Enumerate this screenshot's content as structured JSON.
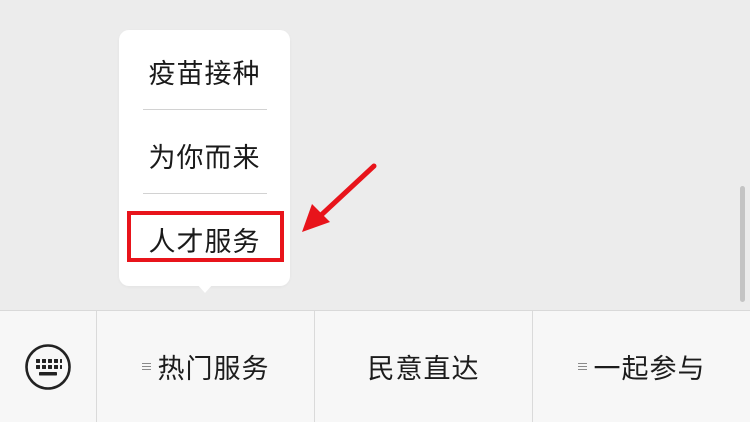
{
  "submenu": {
    "items": [
      {
        "label": "疫苗接种"
      },
      {
        "label": "为你而来"
      },
      {
        "label": "人才服务"
      }
    ],
    "highlighted_index": 2
  },
  "menu_bar": {
    "keyboard_icon": "keyboard-icon",
    "items": [
      {
        "label": "热门服务",
        "has_submenu": true
      },
      {
        "label": "民意直达",
        "has_submenu": false
      },
      {
        "label": "一起参与",
        "has_submenu": true
      }
    ]
  },
  "colors": {
    "highlight": "#e8141b",
    "background": "#ececec",
    "menu_bar": "#f7f7f7"
  }
}
